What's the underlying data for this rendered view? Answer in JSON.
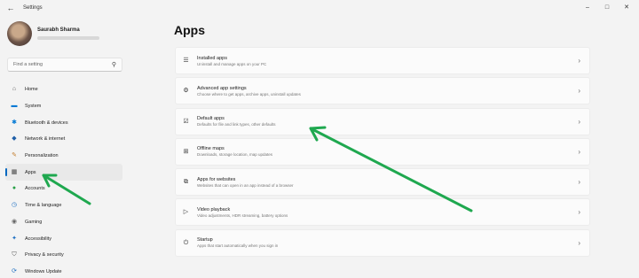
{
  "window": {
    "back_glyph": "←",
    "title": "Settings",
    "controls": [
      "–",
      "□",
      "✕"
    ]
  },
  "profile": {
    "name": "Saurabh Sharma"
  },
  "search": {
    "placeholder": "Find a setting"
  },
  "nav": {
    "items": [
      {
        "label": "Home",
        "icon": "home-icon",
        "glyph": "⌂",
        "color": "#5a5a5a"
      },
      {
        "label": "System",
        "icon": "monitor-icon",
        "glyph": "▬",
        "color": "#0078d4"
      },
      {
        "label": "Bluetooth & devices",
        "icon": "bluetooth-icon",
        "glyph": "✱",
        "color": "#0078d4"
      },
      {
        "label": "Network & internet",
        "icon": "wifi-icon",
        "glyph": "◆",
        "color": "#1f5fa8"
      },
      {
        "label": "Personalization",
        "icon": "brush-icon",
        "glyph": "✎",
        "color": "#c27c2c"
      },
      {
        "label": "Apps",
        "icon": "apps-icon",
        "glyph": "▦",
        "color": "#444"
      },
      {
        "label": "Accounts",
        "icon": "person-icon",
        "glyph": "●",
        "color": "#28a046"
      },
      {
        "label": "Time & language",
        "icon": "globe-clock-icon",
        "glyph": "◷",
        "color": "#1e6fc2"
      },
      {
        "label": "Gaming",
        "icon": "controller-icon",
        "glyph": "◉",
        "color": "#666"
      },
      {
        "label": "Accessibility",
        "icon": "accessibility-icon",
        "glyph": "✦",
        "color": "#1e6fc2"
      },
      {
        "label": "Privacy & security",
        "icon": "shield-icon",
        "glyph": "⛉",
        "color": "#555"
      },
      {
        "label": "Windows Update",
        "icon": "update-icon",
        "glyph": "⟳",
        "color": "#1e6fc2"
      }
    ],
    "selected_index": 5
  },
  "main": {
    "title": "Apps",
    "items": [
      {
        "title": "Installed apps",
        "desc": "Uninstall and manage apps on your PC",
        "icon": "list-icon",
        "glyph": "☰"
      },
      {
        "title": "Advanced app settings",
        "desc": "Choose where to get apps, archive apps, uninstall updates",
        "icon": "app-settings-icon",
        "glyph": "⚙"
      },
      {
        "title": "Default apps",
        "desc": "Defaults for file and link types, other defaults",
        "icon": "default-apps-icon",
        "glyph": "☑"
      },
      {
        "title": "Offline maps",
        "desc": "Downloads, storage location, map updates",
        "icon": "map-icon",
        "glyph": "⊞"
      },
      {
        "title": "Apps for websites",
        "desc": "Websites that can open in an app instead of a browser",
        "icon": "link-icon",
        "glyph": "⧉"
      },
      {
        "title": "Video playback",
        "desc": "Video adjustments, HDR streaming, battery options",
        "icon": "video-icon",
        "glyph": "▷"
      },
      {
        "title": "Startup",
        "desc": "Apps that start automatically when you sign in",
        "icon": "startup-icon",
        "glyph": "⏻"
      }
    ],
    "chevron": "›"
  },
  "annotation_color": "#1fa84f"
}
